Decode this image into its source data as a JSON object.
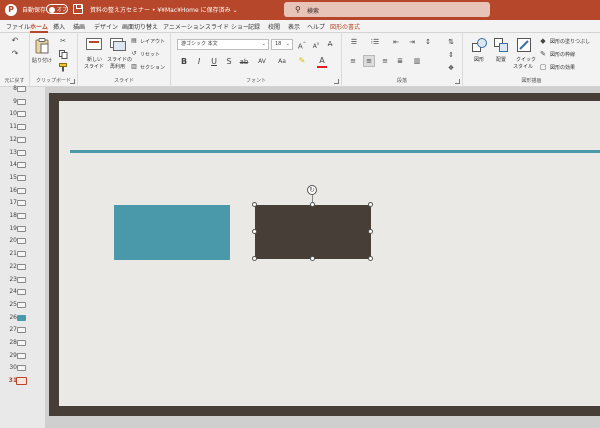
{
  "titlebar": {
    "autosave_label": "自動保存",
    "autosave_state": "オフ",
    "doc_title": "資料の整え方セミナー • ¥¥Mac¥Home に保存済み ⌄",
    "search_placeholder": "検索"
  },
  "tabs": [
    "ファイル",
    "ホーム",
    "挿入",
    "描画",
    "デザイン",
    "画面切り替え",
    "アニメーション",
    "スライド ショー",
    "記録",
    "校閲",
    "表示",
    "ヘルプ",
    "図形の書式"
  ],
  "active_tab": "ホーム",
  "ribbon": {
    "undo_group_label": "元に戻す",
    "clipboard": {
      "label": "クリップボード",
      "paste_label": "貼り付け"
    },
    "slides": {
      "label": "スライド",
      "new_slide_line1": "新しい",
      "new_slide_line2": "スライド",
      "reuse_line1": "スライドの",
      "reuse_line2": "再利用",
      "layout_label": "レイアウト",
      "reset_label": "リセット",
      "section_label": "セクション"
    },
    "font": {
      "label": "フォント",
      "font_name": "游ゴシック 本文",
      "font_size": "18"
    },
    "paragraph": {
      "label": "段落"
    },
    "drawing": {
      "label": "図形描画",
      "shapes_label": "図形",
      "arrange_label": "配置",
      "quick_style_line1": "クイック",
      "quick_style_line2": "スタイル",
      "fill_label": "図形の塗りつぶし",
      "outline_label": "図形の枠線",
      "effects_label": "図形の効果"
    }
  },
  "thumbnails": [
    {
      "num": "8"
    },
    {
      "num": "9"
    },
    {
      "num": "10"
    },
    {
      "num": "11"
    },
    {
      "num": "12"
    },
    {
      "num": "13"
    },
    {
      "num": "14"
    },
    {
      "num": "15"
    },
    {
      "num": "16"
    },
    {
      "num": "17"
    },
    {
      "num": "18"
    },
    {
      "num": "19"
    },
    {
      "num": "20"
    },
    {
      "num": "21"
    },
    {
      "num": "22"
    },
    {
      "num": "23"
    },
    {
      "num": "24"
    },
    {
      "num": "25"
    },
    {
      "num": "26"
    },
    {
      "num": "27"
    },
    {
      "num": "28"
    },
    {
      "num": "29"
    },
    {
      "num": "30"
    },
    {
      "num": "31"
    }
  ],
  "active_thumbnail": "31",
  "colors": {
    "accent": "#b7472a",
    "slide_frame": "#473f37",
    "slide_background": "#eae9e5",
    "teal": "#4a99ab",
    "dark_shape": "#473f37"
  },
  "icons": [
    "powerpoint-logo-icon",
    "save-icon",
    "search-icon",
    "undo-icon",
    "redo-icon",
    "paste-icon",
    "cut-icon",
    "copy-icon",
    "format-painter-icon",
    "new-slide-icon",
    "reuse-slide-icon",
    "layout-icon",
    "reset-icon",
    "section-icon",
    "bold-icon",
    "italic-icon",
    "underline-icon",
    "strikethrough-icon",
    "highlight-icon",
    "font-color-icon",
    "bullets-icon",
    "numbering-icon",
    "align-left-icon",
    "align-center-icon",
    "align-right-icon",
    "justify-icon",
    "columns-icon",
    "shapes-icon",
    "arrange-icon",
    "quick-styles-icon",
    "shape-fill-icon",
    "shape-outline-icon",
    "shape-effects-icon",
    "rotate-handle-icon"
  ]
}
